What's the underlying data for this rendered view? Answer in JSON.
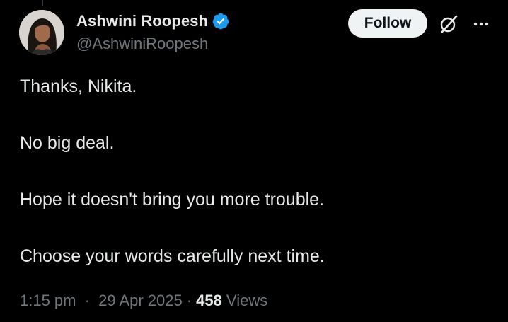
{
  "author": {
    "display_name": "Ashwini Roopesh",
    "handle": "@AshwiniRoopesh",
    "verified": true,
    "avatar_icon": "profile-photo"
  },
  "actions": {
    "follow_label": "Follow",
    "grok_icon": "grok-icon",
    "more_icon": "more-options-icon"
  },
  "tweet": {
    "paragraphs": [
      "Thanks, Nikita.",
      "No big deal.",
      "Hope it doesn't bring you more trouble.",
      "Choose your words carefully next time."
    ]
  },
  "meta": {
    "time": "1:15 pm",
    "separator": "·",
    "date": "29 Apr 2025",
    "views_count": "458",
    "views_label": "Views"
  },
  "colors": {
    "background": "#000000",
    "text_primary": "#e7e9ea",
    "text_secondary": "#71767b",
    "verified_badge": "#1d9bf0",
    "follow_button_bg": "#eff3f4"
  }
}
